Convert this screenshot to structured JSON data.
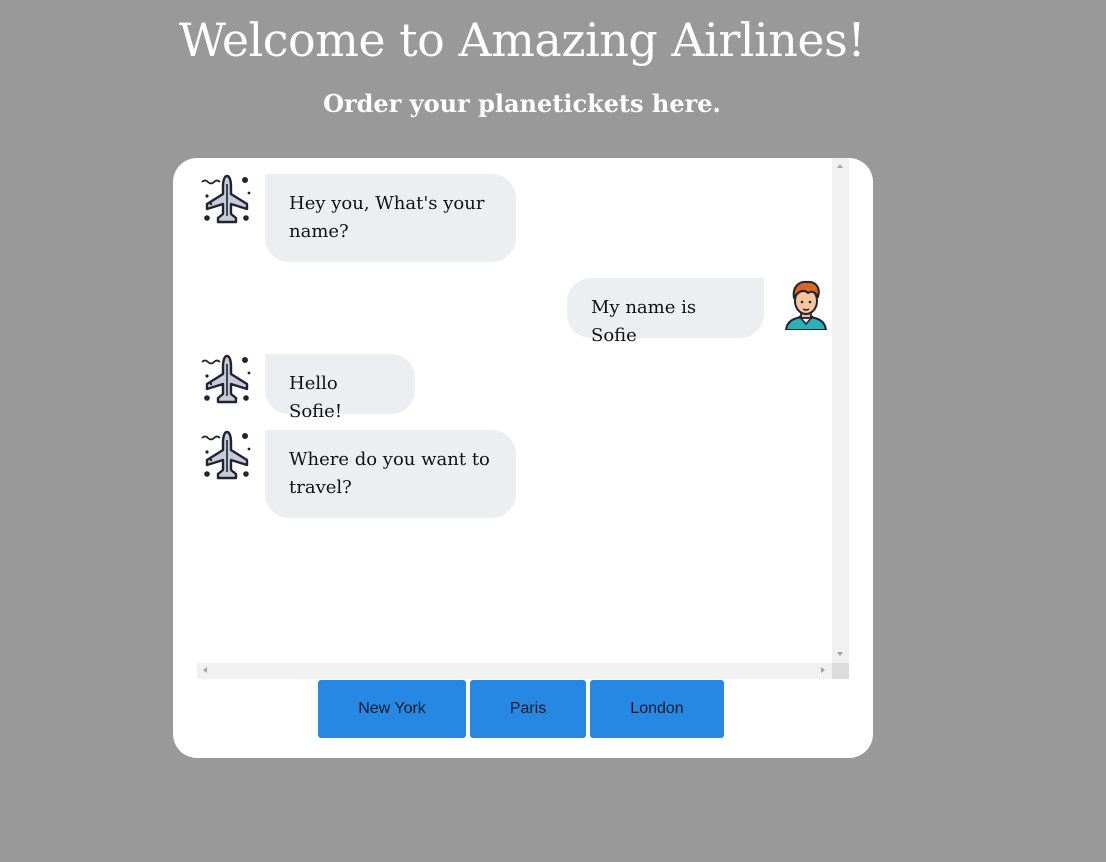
{
  "header": {
    "title": "Welcome to Amazing Airlines!",
    "subtitle": "Order your planetickets here."
  },
  "chat": {
    "messages": [
      {
        "sender": "bot",
        "avatar_icon": "airplane-icon",
        "text": "Hey you, What's your name?"
      },
      {
        "sender": "user",
        "avatar_icon": "user-avatar-icon",
        "text": "My name is Sofie"
      },
      {
        "sender": "bot",
        "avatar_icon": "airplane-icon",
        "text": "Hello Sofie!"
      },
      {
        "sender": "bot",
        "avatar_icon": "airplane-icon",
        "text": "Where do you want to travel?"
      }
    ]
  },
  "options": [
    {
      "label": "New York"
    },
    {
      "label": "Paris"
    },
    {
      "label": "London"
    }
  ],
  "colors": {
    "page_background": "#999999",
    "card_background": "#ffffff",
    "bubble_background": "#eceef2",
    "button_background": "#2688e3"
  }
}
